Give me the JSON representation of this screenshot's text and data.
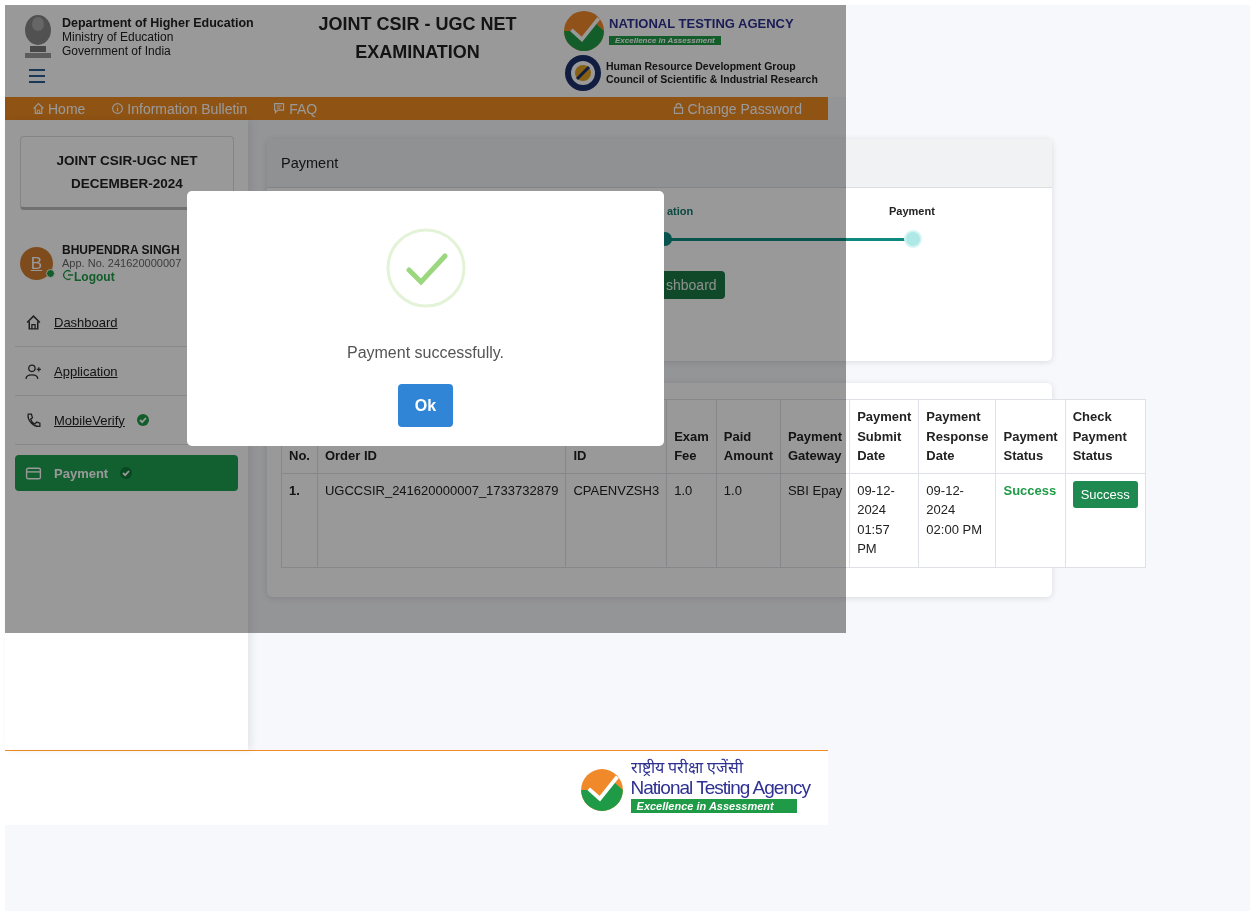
{
  "header": {
    "department": [
      "Department of Higher Education",
      "Ministry of Education",
      "Government of India"
    ],
    "title": [
      "JOINT CSIR - UGC NET",
      "EXAMINATION"
    ],
    "agency": "NATIONAL TESTING AGENCY",
    "tagline": "Excellence in Assessment",
    "council": [
      "Human Resource Development Group",
      "Council of Scientific & Industrial Research"
    ]
  },
  "nav": {
    "left": [
      {
        "label": "Home"
      },
      {
        "label": "Information Bulletin"
      },
      {
        "label": "FAQ"
      }
    ],
    "right": [
      {
        "label": "Change Password"
      }
    ]
  },
  "sidebar": {
    "exam": [
      "JOINT CSIR-UGC NET",
      "DECEMBER-2024"
    ],
    "user": {
      "initial": "B",
      "name": "BHUPENDRA SINGH",
      "app_no": "App. No. 241620000007",
      "online": true,
      "logout": "Logout"
    },
    "items": [
      {
        "label": "Dashboard",
        "verified": false,
        "selected": false
      },
      {
        "label": "Application",
        "verified": false,
        "selected": false
      },
      {
        "label": "MobileVerify",
        "verified": true,
        "selected": false
      },
      {
        "label": "Payment",
        "verified": true,
        "selected": true
      }
    ]
  },
  "payment_card": {
    "title": "Payment",
    "steps": [
      {
        "label": "ation",
        "done": true
      },
      {
        "label": "Payment",
        "done": false
      }
    ],
    "button": "shboard"
  },
  "table": {
    "columns": [
      "No.",
      "Order ID",
      "ID",
      "Exam Fee",
      "Paid Amount",
      "Payment Gateway",
      "Payment Submit Date",
      "Payment Response Date",
      "Payment Status",
      "Check Payment Status"
    ],
    "rows": [
      {
        "cells": [
          "1.",
          "UGCCSIR_241620000007_1733732879",
          "CPAENVZSH3",
          "1.0",
          "1.0",
          "SBI Epay",
          "09-12-2024 01:57 PM",
          "09-12-2024 02:00 PM"
        ],
        "status": "Success",
        "action": "Success"
      }
    ]
  },
  "modal": {
    "message": "Payment successfully.",
    "button": "Ok"
  },
  "footer": {
    "hindi": "राष्ट्रीय परीक्षा एजेंसी",
    "name": "National Testing Agency",
    "tagline": "Excellence in Assessment"
  }
}
